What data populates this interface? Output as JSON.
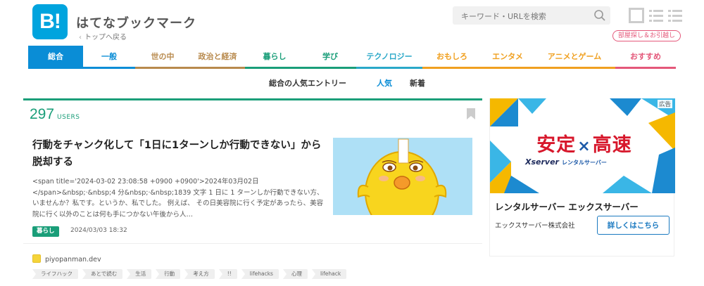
{
  "header": {
    "logo_text": "B!",
    "title": "はてなブックマーク",
    "back_link": "トップへ戻る"
  },
  "search": {
    "placeholder": "キーワード・URLを検索"
  },
  "promo_badge": "部屋探し＆お引越し",
  "nav": {
    "items": [
      {
        "label": "総合",
        "color": "#0a8dd6",
        "active": true
      },
      {
        "label": "一般",
        "color": "#0a8dd6"
      },
      {
        "label": "世の中",
        "color": "#b88a4d"
      },
      {
        "label": "政治と経済",
        "color": "#b88a4d"
      },
      {
        "label": "暮らし",
        "color": "#1a9e79"
      },
      {
        "label": "学び",
        "color": "#1a9e79"
      },
      {
        "label": "テクノロジー",
        "color": "#2aa8c8"
      },
      {
        "label": "おもしろ",
        "color": "#f0a020"
      },
      {
        "label": "エンタメ",
        "color": "#f0a020"
      },
      {
        "label": "アニメとゲーム",
        "color": "#f0a020"
      },
      {
        "label": "おすすめ",
        "color": "#e4587a"
      }
    ]
  },
  "subnav": {
    "title": "総合の人気エントリー",
    "popular": "人気",
    "new": "新着"
  },
  "entry": {
    "users_count": "297",
    "users_label": "USERS",
    "title": "行動をチャンク化して「1日に1ターンしか行動できない」から脱却する",
    "description": "<span title='2024-03-02 23:08:58 +0900 +0900'>2024年03月02日</span>&nbsp;·&nbsp;4 分&nbsp;·&nbsp;1839 文字 1 日に 1 ターンしか行動できない方、いませんか？私です。というか、私でした。 例えば、 その日美容院に行く予定があったら、美容院に行く以外のことは何も手につかない午後から人…",
    "category": "暮らし",
    "date": "2024/03/03 18:32",
    "source": "piyopanman.dev",
    "tags": [
      "ライフハック",
      "あとで読む",
      "生活",
      "行動",
      "考え方",
      "!!",
      "lifehacks",
      "心理",
      "lifehack"
    ]
  },
  "ad": {
    "label": "広告",
    "headline_left": "安定",
    "headline_x": "×",
    "headline_right": "高速",
    "brand": "Xserver",
    "brand_sub": "レンタルサーバー",
    "title": "レンタルサーバー エックスサーバー",
    "company": "エックスサーバー株式会社",
    "cta": "詳しくはこちら"
  }
}
